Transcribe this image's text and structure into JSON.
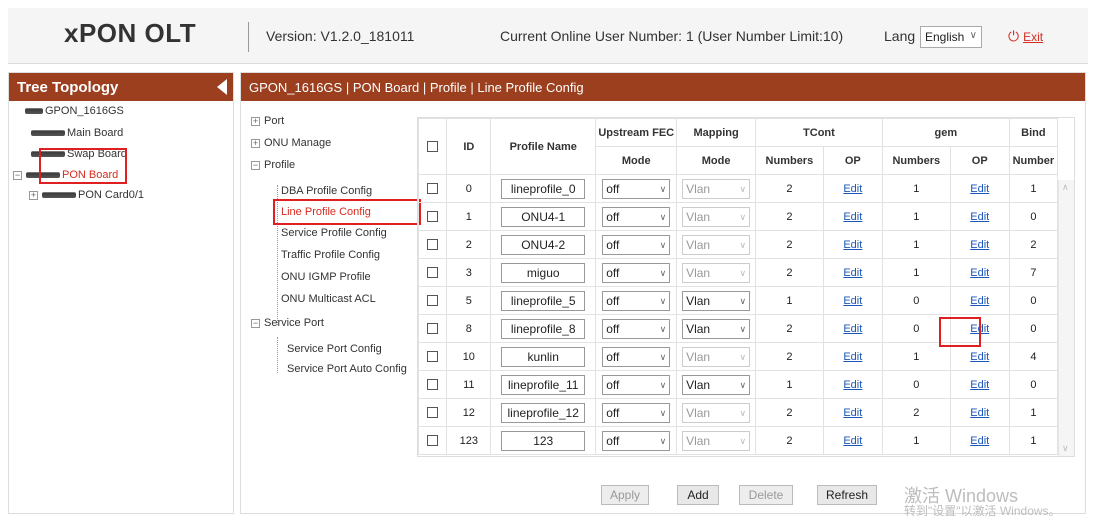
{
  "header": {
    "logo": "xPON OLT",
    "version": "Version: V1.2.0_181011",
    "online": "Current Online User Number: 1 (User Number Limit:10)",
    "lang_label": "Lang",
    "lang_value": "English",
    "exit_label": "Exit",
    "brand_color": "#9b3f1f",
    "exit_color": "#d62b1f"
  },
  "tree": {
    "title": "Tree Topology",
    "root": "GPON_1616GS",
    "main_board": "Main Board",
    "swap_board": "Swap Board",
    "pon_board": "PON Board",
    "pon_card": "PON Card0/1"
  },
  "breadcrumb": "GPON_1616GS | PON Board | Profile | Line Profile Config",
  "menu": {
    "port": "Port",
    "onu_manage": "ONU Manage",
    "profile": "Profile",
    "dba": "DBA Profile Config",
    "line": "Line Profile Config",
    "service": "Service Profile Config",
    "traffic": "Traffic Profile Config",
    "igmp": "ONU IGMP Profile",
    "multicast": "ONU Multicast ACL",
    "service_port": "Service Port",
    "service_port_config": "Service Port Config",
    "service_port_auto": "Service Port Auto Config"
  },
  "table": {
    "headers": {
      "id": "ID",
      "profile_name": "Profile Name",
      "upstream_fec": "Upstream FEC",
      "upstream_fec_mode": "Mode",
      "mapping": "Mapping",
      "mapping_mode": "Mode",
      "tcont": "TCont",
      "tcont_numbers": "Numbers",
      "tcont_op": "OP",
      "gem": "gem",
      "gem_numbers": "Numbers",
      "gem_op": "OP",
      "bind": "Bind",
      "bind_number": "Number"
    },
    "rows": [
      {
        "id": "0",
        "name": "lineprofile_0",
        "fec": "off",
        "mapping": "Vlan",
        "mapping_enabled": false,
        "tcont": "2",
        "tcont_op": "Edit",
        "gem": "1",
        "gem_op": "Edit",
        "bind": "1"
      },
      {
        "id": "1",
        "name": "ONU4-1",
        "fec": "off",
        "mapping": "Vlan",
        "mapping_enabled": false,
        "tcont": "2",
        "tcont_op": "Edit",
        "gem": "1",
        "gem_op": "Edit",
        "bind": "0"
      },
      {
        "id": "2",
        "name": "ONU4-2",
        "fec": "off",
        "mapping": "Vlan",
        "mapping_enabled": false,
        "tcont": "2",
        "tcont_op": "Edit",
        "gem": "1",
        "gem_op": "Edit",
        "bind": "2"
      },
      {
        "id": "3",
        "name": "miguo",
        "fec": "off",
        "mapping": "Vlan",
        "mapping_enabled": false,
        "tcont": "2",
        "tcont_op": "Edit",
        "gem": "1",
        "gem_op": "Edit",
        "bind": "7"
      },
      {
        "id": "5",
        "name": "lineprofile_5",
        "fec": "off",
        "mapping": "Vlan",
        "mapping_enabled": true,
        "tcont": "1",
        "tcont_op": "Edit",
        "gem": "0",
        "gem_op": "Edit",
        "bind": "0"
      },
      {
        "id": "8",
        "name": "lineprofile_8",
        "fec": "off",
        "mapping": "Vlan",
        "mapping_enabled": true,
        "tcont": "2",
        "tcont_op": "Edit",
        "gem": "0",
        "gem_op": "Edit",
        "bind": "0"
      },
      {
        "id": "10",
        "name": "kunlin",
        "fec": "off",
        "mapping": "Vlan",
        "mapping_enabled": false,
        "tcont": "2",
        "tcont_op": "Edit",
        "gem": "1",
        "gem_op": "Edit",
        "bind": "4"
      },
      {
        "id": "11",
        "name": "lineprofile_11",
        "fec": "off",
        "mapping": "Vlan",
        "mapping_enabled": true,
        "tcont": "1",
        "tcont_op": "Edit",
        "gem": "0",
        "gem_op": "Edit",
        "bind": "0"
      },
      {
        "id": "12",
        "name": "lineprofile_12",
        "fec": "off",
        "mapping": "Vlan",
        "mapping_enabled": false,
        "tcont": "2",
        "tcont_op": "Edit",
        "gem": "2",
        "gem_op": "Edit",
        "bind": "1"
      },
      {
        "id": "123",
        "name": "123",
        "fec": "off",
        "mapping": "Vlan",
        "mapping_enabled": false,
        "tcont": "2",
        "tcont_op": "Edit",
        "gem": "1",
        "gem_op": "Edit",
        "bind": "1"
      }
    ]
  },
  "buttons": {
    "apply": "Apply",
    "add": "Add",
    "delete": "Delete",
    "refresh": "Refresh"
  },
  "watermark": {
    "line1": "激活 Windows",
    "line2": "转到\"设置\"以激活 Windows。"
  }
}
